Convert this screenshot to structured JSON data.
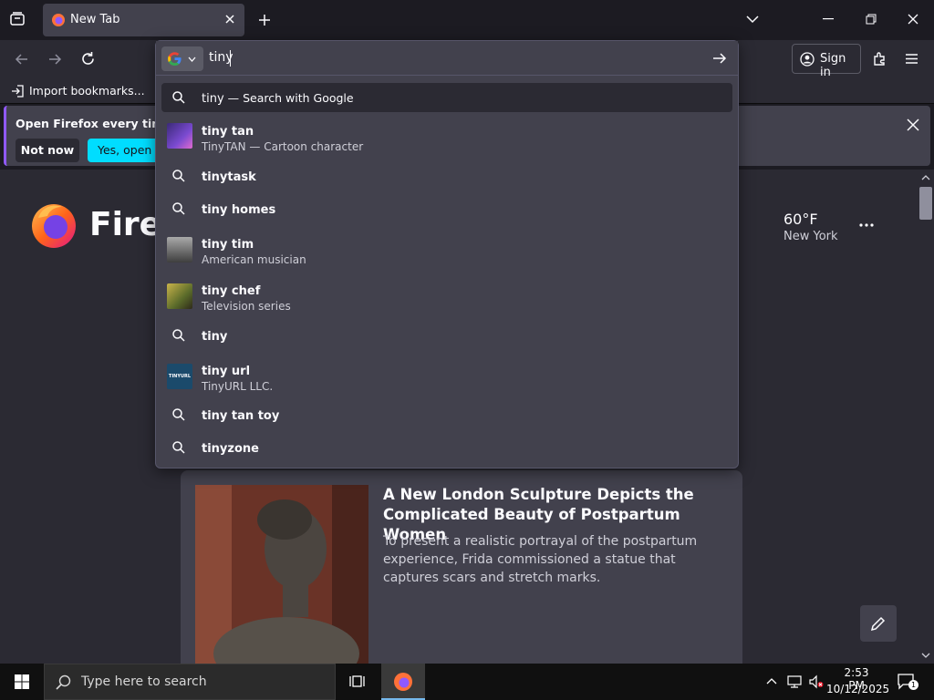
{
  "tab": {
    "title": "New Tab"
  },
  "toolbar": {
    "sign_in": "Sign in"
  },
  "bookmarks": {
    "import_label": "Import bookmarks..."
  },
  "notification": {
    "text": "Open Firefox every time you",
    "not_now": "Not now",
    "yes": "Yes, open Fi"
  },
  "page": {
    "brand": "Firefo"
  },
  "weather": {
    "temp": "60°F",
    "city": "New York"
  },
  "story": {
    "title": "A New London Sculpture Depicts the Complicated Beauty of Postpartum Women",
    "description": "To present a realistic portrayal of the postpartum experience, Frida commissioned a statue that captures scars and stretch marks."
  },
  "urlbar": {
    "value": "tiny",
    "suggestions": [
      {
        "text": "tiny",
        "suffix": " — Search with Google",
        "type": "search"
      },
      {
        "text": "tiny tan",
        "sub": "TinyTAN — Cartoon character",
        "type": "rich"
      },
      {
        "text": "tinytask",
        "type": "search"
      },
      {
        "text": "tiny homes",
        "type": "search"
      },
      {
        "text": "tiny tim",
        "sub": "American musician",
        "type": "rich"
      },
      {
        "text": "tiny chef",
        "sub": "Television series",
        "type": "rich"
      },
      {
        "text": "tiny",
        "type": "search"
      },
      {
        "text": "tiny url",
        "sub": "TinyURL LLC.",
        "type": "rich",
        "thumb_label": "TINYURL"
      },
      {
        "text": "tiny tan toy",
        "type": "search"
      },
      {
        "text": "tinyzone",
        "type": "search"
      }
    ]
  },
  "taskbar": {
    "search_placeholder": "Type here to search",
    "time": "2:53 PM",
    "date": "10/12/2025",
    "notification_count": "1"
  },
  "colors": {
    "accent": "#00ddff",
    "purple": "#9059ff",
    "panel": "#42414d",
    "bg": "#2b2a33"
  }
}
